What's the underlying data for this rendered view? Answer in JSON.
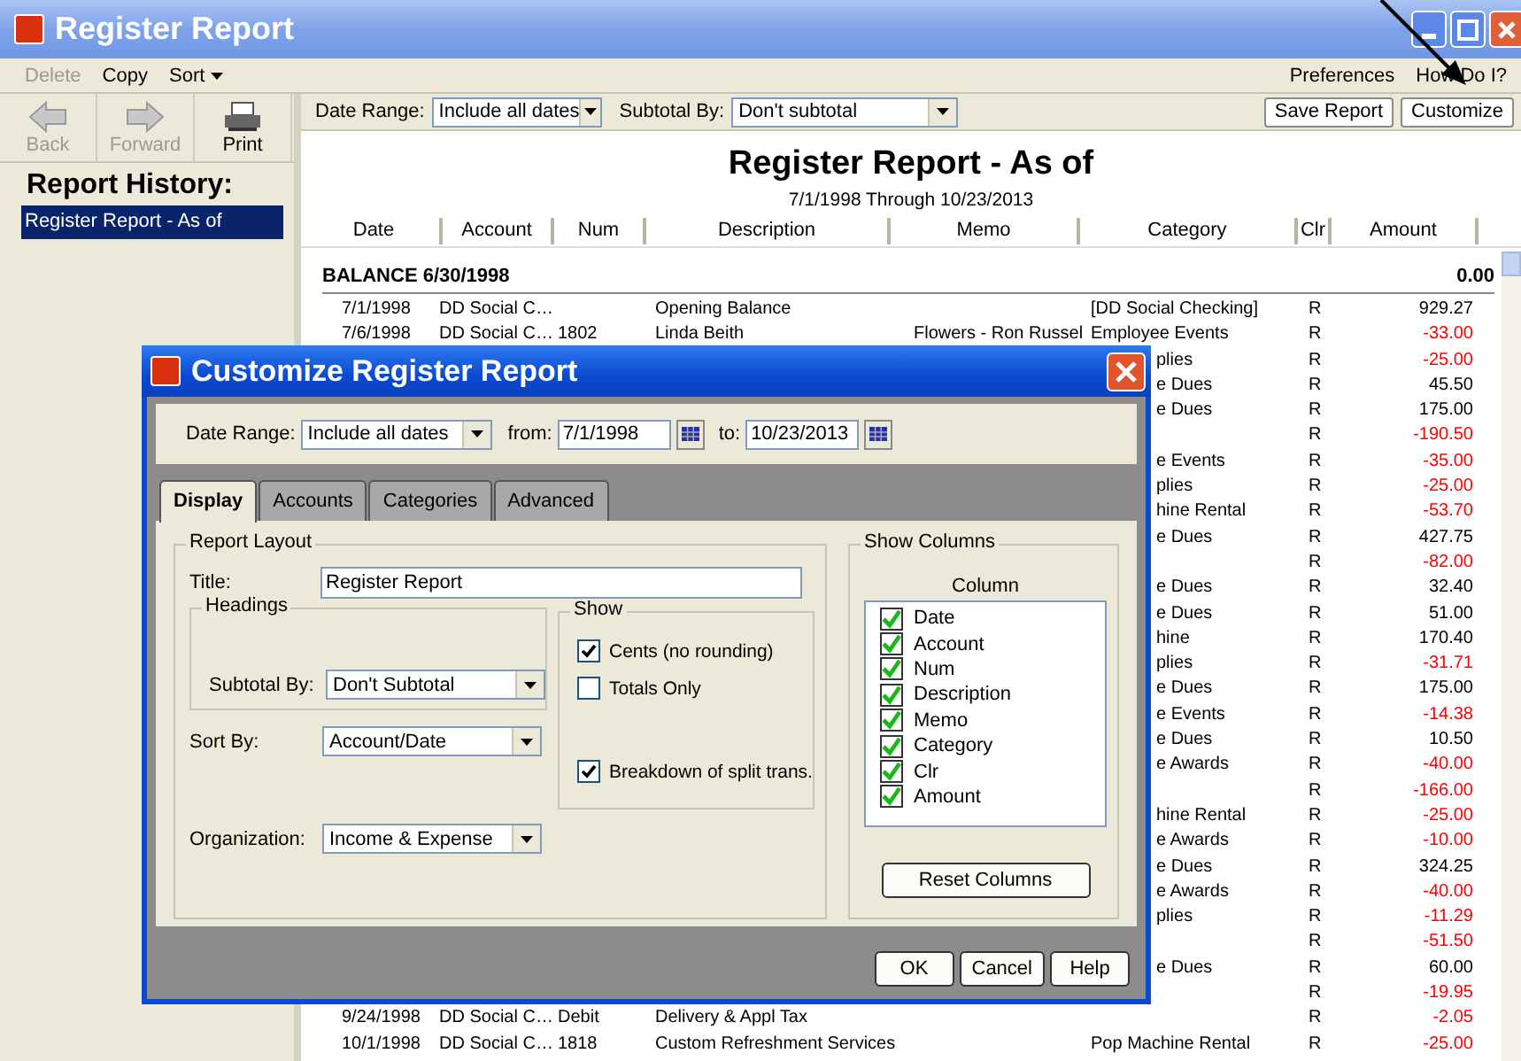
{
  "window": {
    "title": "Register Report"
  },
  "menu": {
    "left": [
      {
        "label": "Delete",
        "disabled": true,
        "kind": "plain"
      },
      {
        "label": "Copy",
        "disabled": false,
        "kind": "plain"
      },
      {
        "label": "Sort",
        "disabled": false,
        "kind": "dropdown"
      }
    ],
    "right": [
      "Preferences",
      "How Do I?"
    ]
  },
  "toolbar": [
    {
      "label": "Back",
      "disabled": true,
      "kind": "back"
    },
    {
      "label": "Forward",
      "disabled": true,
      "kind": "forward"
    },
    {
      "label": "Print",
      "disabled": false,
      "kind": "print"
    }
  ],
  "report_history": {
    "title": "Report History:",
    "items": [
      {
        "label": "Register Report - As of",
        "selected": true
      }
    ]
  },
  "filters": {
    "date_range": {
      "label": "Date Range:",
      "value": "Include all dates"
    },
    "subtotal_by": {
      "label": "Subtotal By:",
      "value": "Don't subtotal"
    },
    "buttons": [
      "Save Report",
      "Customize"
    ]
  },
  "report": {
    "title": "Register Report - As of",
    "subtitle": "7/1/1998 Through 10/23/2013",
    "columns": [
      "Date",
      "Account",
      "Num",
      "Description",
      "Memo",
      "Category",
      "Clr",
      "Amount"
    ],
    "balance": {
      "label": "BALANCE 6/30/1998",
      "amount": "0.00"
    },
    "rows": [
      {
        "kind": "full",
        "date": "7/1/1998",
        "account": "DD Social C…",
        "description": "Opening Balance",
        "category": "[DD Social Checking]",
        "clr": "R",
        "amount": "929.27",
        "negative": false
      },
      {
        "kind": "full",
        "date": "7/6/1998",
        "account": "DD Social C…",
        "num": "1802",
        "description": "Linda Beith",
        "memo": "Flowers - Ron Russel",
        "category": "Employee Events",
        "clr": "R",
        "amount": "-33.00",
        "negative": true
      },
      {
        "kind": "partial",
        "category": "plies",
        "clr": "R",
        "amount": "-25.00",
        "negative": true
      },
      {
        "kind": "partial",
        "category": "e Dues",
        "clr": "R",
        "amount": "45.50",
        "negative": false
      },
      {
        "kind": "partial",
        "category": "e Dues",
        "clr": "R",
        "amount": "175.00",
        "negative": false
      },
      {
        "kind": "partial",
        "clr": "R",
        "amount": "-190.50",
        "negative": true
      },
      {
        "kind": "partial",
        "category": "e Events",
        "clr": "R",
        "amount": "-35.00",
        "negative": true
      },
      {
        "kind": "partial",
        "category": "plies",
        "clr": "R",
        "amount": "-25.00",
        "negative": true
      },
      {
        "kind": "partial",
        "category": "hine Rental",
        "clr": "R",
        "amount": "-53.70",
        "negative": true
      },
      {
        "kind": "partial",
        "category": "e Dues",
        "clr": "R",
        "amount": "427.75",
        "negative": false
      },
      {
        "kind": "partial",
        "clr": "R",
        "amount": "-82.00",
        "negative": true
      },
      {
        "kind": "partial",
        "category": "e Dues",
        "clr": "R",
        "amount": "32.40",
        "negative": false
      },
      {
        "kind": "partial",
        "category": "e Dues",
        "clr": "R",
        "amount": "51.00",
        "negative": false
      },
      {
        "kind": "partial",
        "category": "hine",
        "clr": "R",
        "amount": "170.40",
        "negative": false
      },
      {
        "kind": "partial",
        "category": "plies",
        "clr": "R",
        "amount": "-31.71",
        "negative": true
      },
      {
        "kind": "partial",
        "category": "e Dues",
        "clr": "R",
        "amount": "175.00",
        "negative": false
      },
      {
        "kind": "partial",
        "category": "e Events",
        "clr": "R",
        "amount": "-14.38",
        "negative": true
      },
      {
        "kind": "partial",
        "category": "e Dues",
        "clr": "R",
        "amount": "10.50",
        "negative": false
      },
      {
        "kind": "partial",
        "category": "e Awards",
        "clr": "R",
        "amount": "-40.00",
        "negative": true
      },
      {
        "kind": "partial",
        "clr": "R",
        "amount": "-166.00",
        "negative": true
      },
      {
        "kind": "partial",
        "category": "hine Rental",
        "clr": "R",
        "amount": "-25.00",
        "negative": true
      },
      {
        "kind": "partial",
        "category": "e Awards",
        "clr": "R",
        "amount": "-10.00",
        "negative": true
      },
      {
        "kind": "partial",
        "category": "e Dues",
        "clr": "R",
        "amount": "324.25",
        "negative": false
      },
      {
        "kind": "partial",
        "category": "e Awards",
        "clr": "R",
        "amount": "-40.00",
        "negative": true
      },
      {
        "kind": "partial",
        "category": "plies",
        "clr": "R",
        "amount": "-11.29",
        "negative": true
      },
      {
        "kind": "partial",
        "clr": "R",
        "amount": "-51.50",
        "negative": true
      },
      {
        "kind": "partial",
        "category": "e Dues",
        "clr": "R",
        "amount": "60.00",
        "negative": false
      },
      {
        "kind": "partial",
        "clr": "R",
        "amount": "-19.95",
        "negative": true
      },
      {
        "kind": "full",
        "date": "9/24/1998",
        "account": "DD Social C…",
        "num": "Debit",
        "description": "Delivery & Appl Tax",
        "clr": "R",
        "amount": "-2.05",
        "negative": true
      },
      {
        "kind": "full",
        "date": "10/1/1998",
        "account": "DD Social C…",
        "num": "1818",
        "description": "Custom Refreshment Services",
        "category": "Pop Machine Rental",
        "clr": "R",
        "amount": "-25.00",
        "negative": true
      }
    ]
  },
  "dialog": {
    "title": "Customize Register Report",
    "date_range": {
      "label": "Date Range:",
      "value": "Include all dates"
    },
    "from": {
      "label": "from:",
      "value": "7/1/1998"
    },
    "to": {
      "label": "to:",
      "value": "10/23/2013"
    },
    "tabs": [
      {
        "label": "Display",
        "selected": true
      },
      {
        "label": "Accounts",
        "selected": false
      },
      {
        "label": "Categories",
        "selected": false
      },
      {
        "label": "Advanced",
        "selected": false
      }
    ],
    "report_layout": {
      "legend": "Report Layout",
      "title_label": "Title:",
      "title_value": "Register Report",
      "headings_legend": "Headings",
      "subtotal": {
        "label": "Subtotal By:",
        "value": "Don't Subtotal"
      },
      "sort": {
        "label": "Sort By:",
        "value": "Account/Date"
      },
      "organization": {
        "label": "Organization:",
        "value": "Income & Expense"
      }
    },
    "show": {
      "legend": "Show",
      "options": [
        {
          "label": "Cents (no rounding)",
          "checked": true
        },
        {
          "label": "Totals Only",
          "checked": false
        },
        {
          "label": "Breakdown of split trans.",
          "checked": true
        }
      ]
    },
    "show_columns": {
      "legend": "Show Columns",
      "header": "Column",
      "items": [
        {
          "label": "Date",
          "checked": true
        },
        {
          "label": "Account",
          "checked": true
        },
        {
          "label": "Num",
          "checked": true
        },
        {
          "label": "Description",
          "checked": true
        },
        {
          "label": "Memo",
          "checked": true
        },
        {
          "label": "Category",
          "checked": true
        },
        {
          "label": "Clr",
          "checked": true
        },
        {
          "label": "Amount",
          "checked": true
        }
      ],
      "reset": "Reset Columns"
    },
    "buttons": [
      "OK",
      "Cancel",
      "Help"
    ]
  }
}
